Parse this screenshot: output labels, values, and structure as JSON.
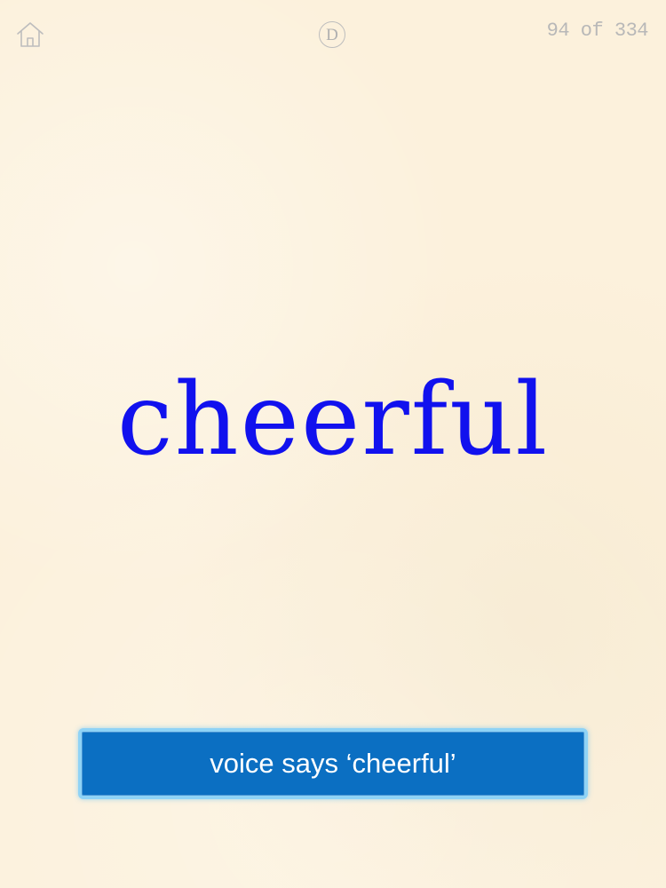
{
  "header": {
    "home_icon": "home-icon",
    "mode_label": "D",
    "page_counter": "94 of 334"
  },
  "card": {
    "word": "cheerful",
    "word_color": "#1111ee"
  },
  "voice_button": {
    "label": "voice says ‘cheerful’",
    "background_color": "#0b6fc2",
    "border_color": "#8fd3f6"
  },
  "colors": {
    "background": "#fcf1dc",
    "icon_gray": "#bdbdbd"
  }
}
